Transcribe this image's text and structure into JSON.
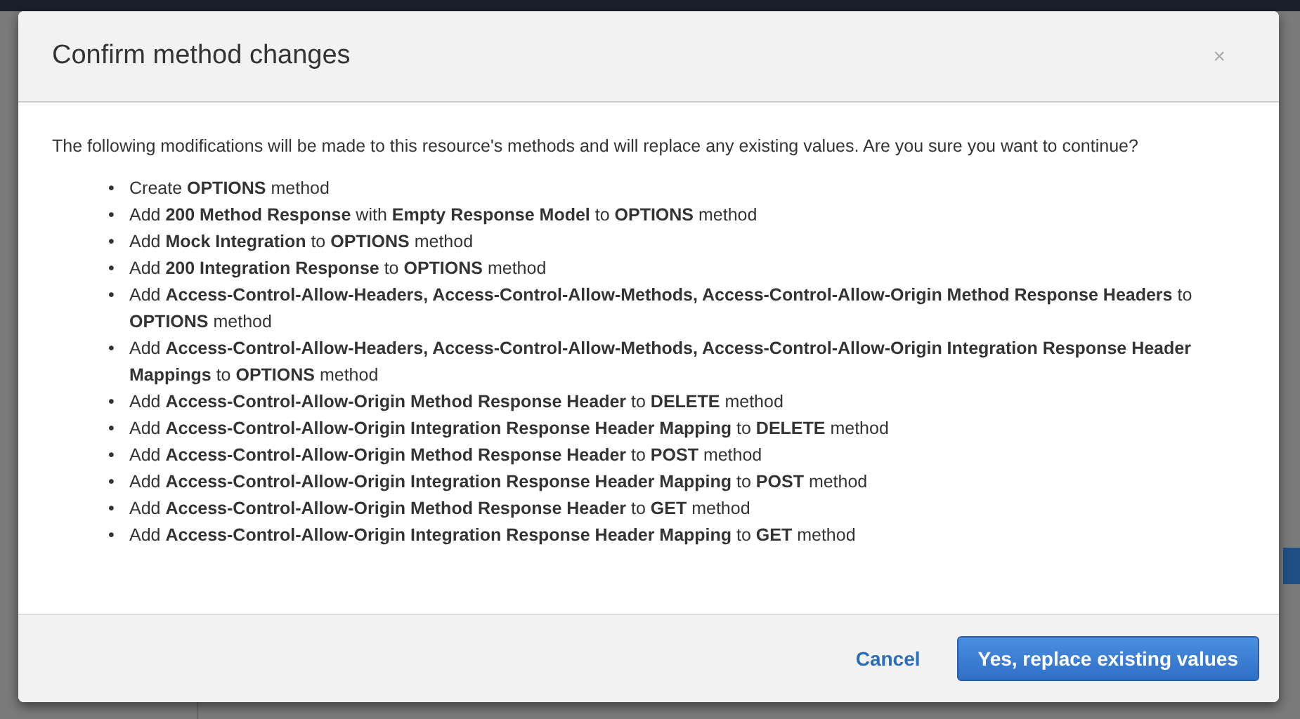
{
  "dialog": {
    "title": "Confirm method changes",
    "close": "×",
    "intro": "The following modifications will be made to this resource's methods and will replace any existing values. Are you sure you want to continue?",
    "bullet": "•",
    "items": [
      "Create **OPTIONS** method",
      "Add **200 Method Response** with **Empty Response Model** to **OPTIONS** method",
      "Add **Mock Integration** to **OPTIONS** method",
      "Add **200 Integration Response** to **OPTIONS** method",
      "Add **Access-Control-Allow-Headers, Access-Control-Allow-Methods, Access-Control-Allow-Origin Method Response Headers** to **OPTIONS** method",
      "Add **Access-Control-Allow-Headers, Access-Control-Allow-Methods, Access-Control-Allow-Origin Integration Response Header Mappings** to **OPTIONS** method",
      "Add **Access-Control-Allow-Origin Method Response Header** to **DELETE** method",
      "Add **Access-Control-Allow-Origin Integration Response Header Mapping** to **DELETE** method",
      "Add **Access-Control-Allow-Origin Method Response Header** to **POST** method",
      "Add **Access-Control-Allow-Origin Integration Response Header Mapping** to **POST** method",
      "Add **Access-Control-Allow-Origin Method Response Header** to **GET** method",
      "Add **Access-Control-Allow-Origin Integration Response Header Mapping** to **GET** method"
    ],
    "cancel": "Cancel",
    "confirm": "Yes, replace existing values"
  }
}
